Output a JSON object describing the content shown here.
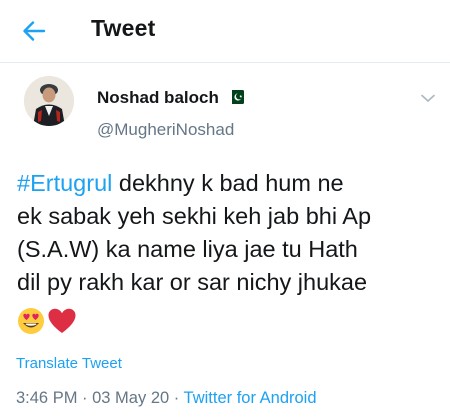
{
  "header": {
    "title": "Tweet",
    "back_icon": "arrow-left-icon"
  },
  "author": {
    "display_name": "Noshad baloch",
    "handle": "@MugheriNoshad",
    "flag_icon": "pakistan-flag-icon"
  },
  "tweet": {
    "hashtag": "#Ertugrul",
    "line1_rest": " dekhny k bad hum ne",
    "line2": "ek sabak yeh sekhi keh jab bhi Ap",
    "line3": "(S.A.W) ka name liya jae tu Hath",
    "line4": "dil py rakh kar or sar nichy jhukae",
    "emojis": [
      "heart-eyes-emoji",
      "red-heart-emoji"
    ]
  },
  "translate_label": "Translate Tweet",
  "meta": {
    "time": "3:46 PM",
    "separator": " · ",
    "date": "03 May 20",
    "source": "Twitter for Android"
  },
  "colors": {
    "accent": "#1da1f2",
    "secondary_text": "#657786",
    "primary_text": "#14171a"
  }
}
